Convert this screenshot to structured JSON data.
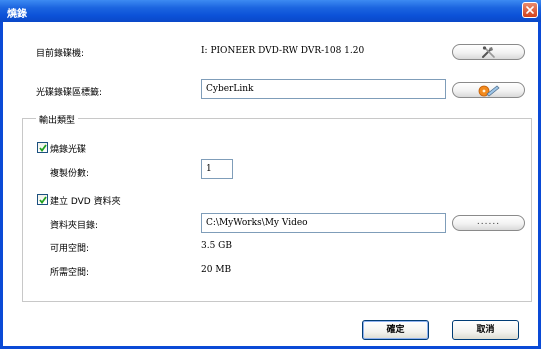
{
  "window": {
    "title": "燒錄"
  },
  "recorder": {
    "label": "目前錄碟機:",
    "value": "I: PIONEER DVD-RW  DVR-108 1.20"
  },
  "disc_label": {
    "label": "光碟錄碟區標籤:",
    "value": "CyberLink"
  },
  "output": {
    "group_label": "輸出類型",
    "burn_disc": {
      "label": "燒錄光碟",
      "checked": true
    },
    "copies": {
      "label": "複製份數:",
      "value": "1"
    },
    "create_dvd_folder": {
      "label": "建立 DVD 資料夾",
      "checked": true
    },
    "folder_dir": {
      "label": "資料夾目錄:",
      "value": "C:\\MyWorks\\My Video",
      "browse_label": "......"
    },
    "available_space": {
      "label": "可用空間:",
      "value": "3.5 GB"
    },
    "required_space": {
      "label": "所需空間:",
      "value": "20 MB"
    }
  },
  "buttons": {
    "ok": "確定",
    "cancel": "取消"
  },
  "icons": {
    "settings": "tools-icon",
    "edit_label": "disc-pen-icon",
    "close": "close-icon"
  }
}
